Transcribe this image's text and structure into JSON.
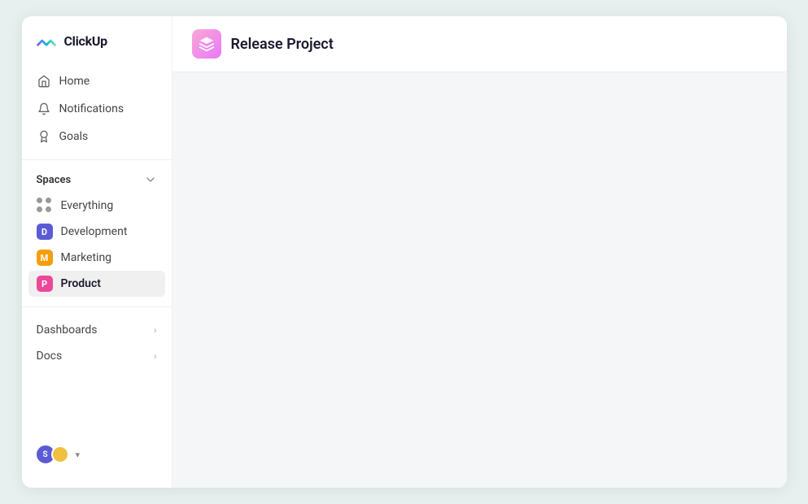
{
  "logo": {
    "text": "ClickUp"
  },
  "nav": {
    "home_label": "Home",
    "notifications_label": "Notifications",
    "goals_label": "Goals"
  },
  "spaces": {
    "label": "Spaces",
    "items": [
      {
        "id": "everything",
        "label": "Everything",
        "type": "dots"
      },
      {
        "id": "development",
        "label": "Development",
        "initial": "D",
        "color": "#5b5bd6"
      },
      {
        "id": "marketing",
        "label": "Marketing",
        "initial": "M",
        "color": "#f59e0b"
      },
      {
        "id": "product",
        "label": "Product",
        "initial": "P",
        "color": "#ec4899",
        "active": true
      }
    ]
  },
  "sections": [
    {
      "id": "dashboards",
      "label": "Dashboards"
    },
    {
      "id": "docs",
      "label": "Docs"
    }
  ],
  "project": {
    "title": "Release Project"
  },
  "bottomNav": {
    "avatar_initial": "S",
    "dropdown_icon": "▾"
  }
}
